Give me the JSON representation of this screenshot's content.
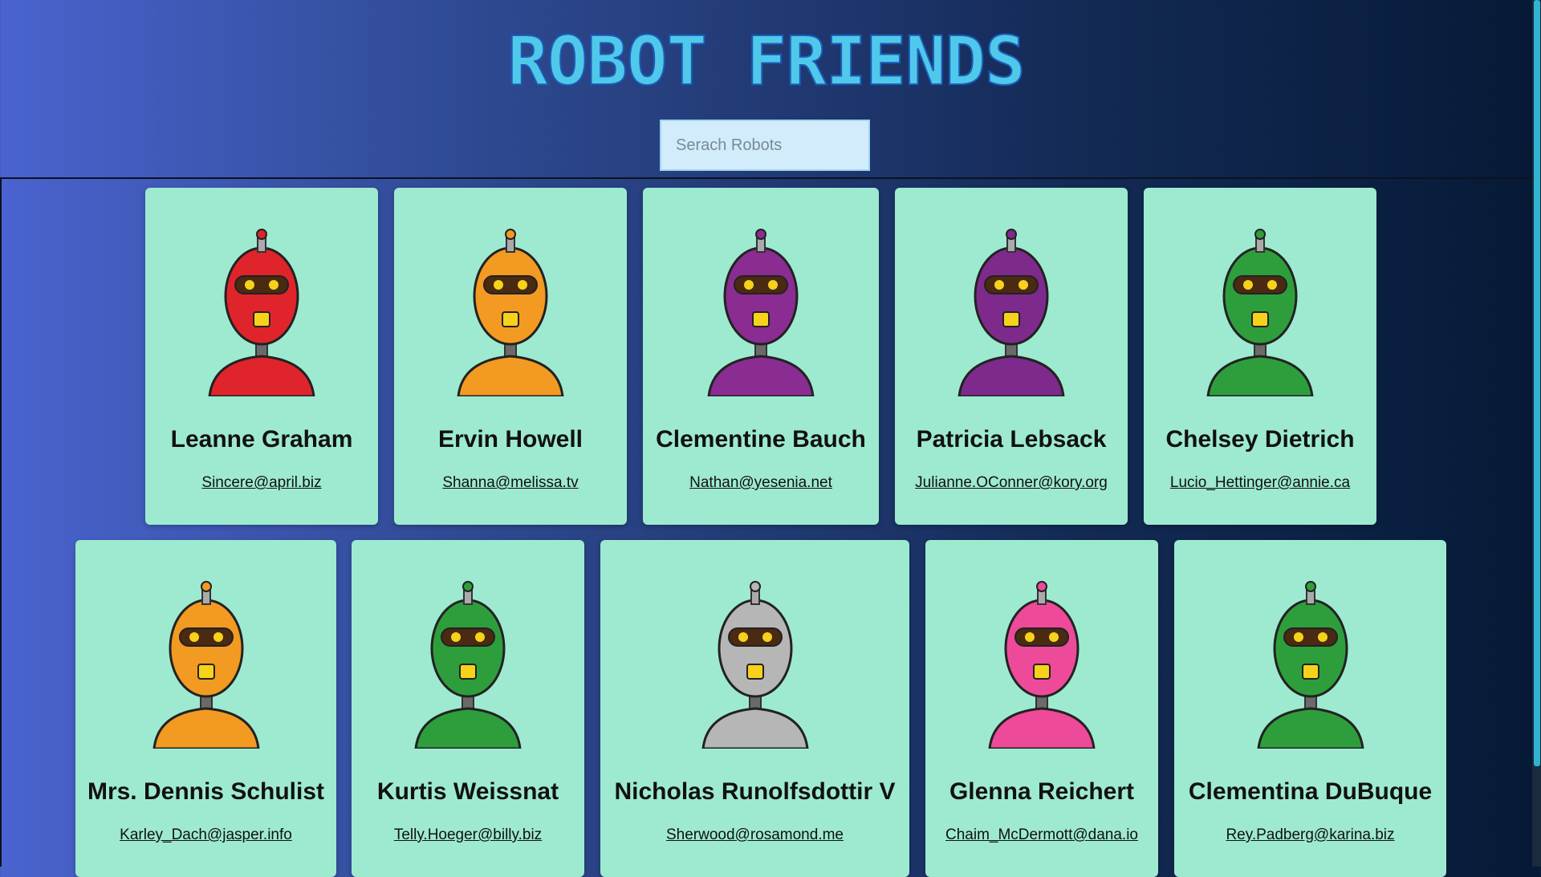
{
  "header": {
    "title": "ROBOT FRIENDS",
    "search_placeholder": "Serach Robots"
  },
  "robots": [
    {
      "name": "Leanne Graham",
      "email": "Sincere@april.biz",
      "color": "#e0242c"
    },
    {
      "name": "Ervin Howell",
      "email": "Shanna@melissa.tv",
      "color": "#f39a22"
    },
    {
      "name": "Clementine Bauch",
      "email": "Nathan@yesenia.net",
      "color": "#8a2c92"
    },
    {
      "name": "Patricia Lebsack",
      "email": "Julianne.OConner@kory.org",
      "color": "#7e2a8c"
    },
    {
      "name": "Chelsey Dietrich",
      "email": "Lucio_Hettinger@annie.ca",
      "color": "#2e9e3c"
    },
    {
      "name": "Mrs. Dennis Schulist",
      "email": "Karley_Dach@jasper.info",
      "color": "#f39a22"
    },
    {
      "name": "Kurtis Weissnat",
      "email": "Telly.Hoeger@billy.biz",
      "color": "#2e9e3c"
    },
    {
      "name": "Nicholas Runolfsdottir V",
      "email": "Sherwood@rosamond.me",
      "color": "#b6b6b6"
    },
    {
      "name": "Glenna Reichert",
      "email": "Chaim_McDermott@dana.io",
      "color": "#ee4a9a"
    },
    {
      "name": "Clementina DuBuque",
      "email": "Rey.Padberg@karina.biz",
      "color": "#2e9e3c"
    }
  ]
}
